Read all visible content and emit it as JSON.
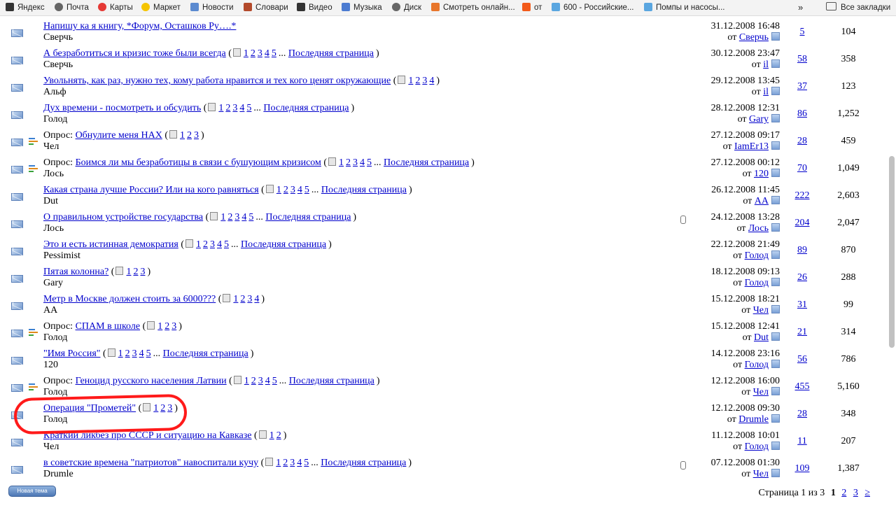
{
  "bookmarks": [
    {
      "label": "Яндекс",
      "icon": "yandex-icon",
      "color": "#333333"
    },
    {
      "label": "Почта",
      "icon": "globe-icon",
      "color": "#666666"
    },
    {
      "label": "Карты",
      "icon": "map-pin-icon",
      "color": "#e53935"
    },
    {
      "label": "Маркет",
      "icon": "market-icon",
      "color": "#f5c400"
    },
    {
      "label": "Новости",
      "icon": "news-icon",
      "color": "#5b8ad0"
    },
    {
      "label": "Словари",
      "icon": "dictionary-icon",
      "color": "#b34a2b"
    },
    {
      "label": "Видео",
      "icon": "video-icon",
      "color": "#333333"
    },
    {
      "label": "Музыка",
      "icon": "music-icon",
      "color": "#4b7bd1"
    },
    {
      "label": "Диск",
      "icon": "globe-icon",
      "color": "#666666"
    },
    {
      "label": "Смотреть онлайн...",
      "icon": "film-icon",
      "color": "#e8762b"
    },
    {
      "label": "от",
      "icon": "fire-icon",
      "color": "#f25a1a"
    },
    {
      "label": "600 - Российские...",
      "icon": "bookmark-icon",
      "color": "#5aa6e0"
    },
    {
      "label": "Помпы и насосы...",
      "icon": "bookmark-icon",
      "color": "#5aa6e0"
    }
  ],
  "bookmarks_more": "»",
  "all_bookmarks": "Все закладки",
  "topics": [
    {
      "prefix": "",
      "title": "Напишу ка я книгу, *Форум, Осташков Ру….*",
      "pages": [],
      "last": false,
      "author": "Сверчь",
      "date": "31.12.2008 16:48",
      "last_by": "Сверчь",
      "replies": "5",
      "views": "104",
      "poll": false,
      "attach": false
    },
    {
      "prefix": "",
      "title": "А безработиться и кризис тоже были всегда",
      "pages": [
        "1",
        "2",
        "3",
        "4",
        "5"
      ],
      "last": true,
      "author": "Сверчь",
      "date": "30.12.2008 23:47",
      "last_by": "il",
      "replies": "58",
      "views": "358",
      "poll": false,
      "attach": false
    },
    {
      "prefix": "",
      "title": "Увольнять, как раз, нужно тех, кому работа нравится и тех кого ценят окружающие",
      "pages": [
        "1",
        "2",
        "3",
        "4"
      ],
      "last": false,
      "author": "Альф",
      "date": "29.12.2008 13:45",
      "last_by": "il",
      "replies": "37",
      "views": "123",
      "poll": false,
      "attach": false
    },
    {
      "prefix": "",
      "title": "Дух времени - посмотреть и обсудить",
      "pages": [
        "1",
        "2",
        "3",
        "4",
        "5"
      ],
      "last": true,
      "author": "Голод",
      "date": "28.12.2008 12:31",
      "last_by": "Gary",
      "replies": "86",
      "views": "1,252",
      "poll": false,
      "attach": false
    },
    {
      "prefix": "Опрос:",
      "title": "Обнулите меня НАХ",
      "pages": [
        "1",
        "2",
        "3"
      ],
      "last": false,
      "author": "Чел",
      "date": "27.12.2008 09:17",
      "last_by": "IamEr13",
      "replies": "28",
      "views": "459",
      "poll": true,
      "attach": false
    },
    {
      "prefix": "Опрос:",
      "title": "Боимся ли мы безработицы в связи с бушующим кризисом",
      "pages": [
        "1",
        "2",
        "3",
        "4",
        "5"
      ],
      "last": true,
      "author": "Лось",
      "date": "27.12.2008 00:12",
      "last_by": "120",
      "replies": "70",
      "views": "1,049",
      "poll": true,
      "attach": false
    },
    {
      "prefix": "",
      "title": "Какая страна лучше России? Или на кого равняться",
      "pages": [
        "1",
        "2",
        "3",
        "4",
        "5"
      ],
      "last": true,
      "author": "Dut",
      "date": "26.12.2008 11:45",
      "last_by": "AA",
      "replies": "222",
      "views": "2,603",
      "poll": false,
      "attach": false
    },
    {
      "prefix": "",
      "title": "О правильном устройстве государства",
      "pages": [
        "1",
        "2",
        "3",
        "4",
        "5"
      ],
      "last": true,
      "author": "Лось",
      "date": "24.12.2008 13:28",
      "last_by": "Лось",
      "replies": "204",
      "views": "2,047",
      "poll": false,
      "attach": true
    },
    {
      "prefix": "",
      "title": "Это и есть истинная демократия",
      "pages": [
        "1",
        "2",
        "3",
        "4",
        "5"
      ],
      "last": true,
      "author": "Pessimist",
      "date": "22.12.2008 21:49",
      "last_by": "Голод",
      "replies": "89",
      "views": "870",
      "poll": false,
      "attach": false
    },
    {
      "prefix": "",
      "title": "Пятая колонна?",
      "pages": [
        "1",
        "2",
        "3"
      ],
      "last": false,
      "author": "Gary",
      "date": "18.12.2008 09:13",
      "last_by": "Голод",
      "replies": "26",
      "views": "288",
      "poll": false,
      "attach": false
    },
    {
      "prefix": "",
      "title": "Метр в Москве должен стоить за 6000???",
      "pages": [
        "1",
        "2",
        "3",
        "4"
      ],
      "last": false,
      "author": "AA",
      "date": "15.12.2008 18:21",
      "last_by": "Чел",
      "replies": "31",
      "views": "99",
      "poll": false,
      "attach": false
    },
    {
      "prefix": "Опрос:",
      "title": "СПАМ в школе",
      "pages": [
        "1",
        "2",
        "3"
      ],
      "last": false,
      "author": "Голод",
      "date": "15.12.2008 12:41",
      "last_by": "Dut",
      "replies": "21",
      "views": "314",
      "poll": true,
      "attach": false
    },
    {
      "prefix": "",
      "title": "\"Имя Россия\"",
      "pages": [
        "1",
        "2",
        "3",
        "4",
        "5"
      ],
      "last": true,
      "author": "120",
      "date": "14.12.2008 23:16",
      "last_by": "Голод",
      "replies": "56",
      "views": "786",
      "poll": false,
      "attach": false
    },
    {
      "prefix": "Опрос:",
      "title": "Геноцид русского населения Латвии",
      "pages": [
        "1",
        "2",
        "3",
        "4",
        "5"
      ],
      "last": true,
      "author": "Голод",
      "date": "12.12.2008 16:00",
      "last_by": "Чел",
      "replies": "455",
      "views": "5,160",
      "poll": true,
      "attach": false
    },
    {
      "prefix": "",
      "title": "Операция \"Прометей\"",
      "pages": [
        "1",
        "2",
        "3"
      ],
      "last": false,
      "author": "Голод",
      "date": "12.12.2008 09:30",
      "last_by": "Drumle",
      "replies": "28",
      "views": "348",
      "poll": false,
      "attach": false
    },
    {
      "prefix": "",
      "title": "Краткий ликбез про СССР и ситуацию на Кавказе",
      "pages": [
        "1",
        "2"
      ],
      "last": false,
      "author": "Чел",
      "date": "11.12.2008 10:01",
      "last_by": "Голод",
      "replies": "11",
      "views": "207",
      "poll": false,
      "attach": false
    },
    {
      "prefix": "",
      "title": "в советские времена \"патриотов\" навоспитали кучу",
      "pages": [
        "1",
        "2",
        "3",
        "4",
        "5"
      ],
      "last": true,
      "author": "Drumle",
      "date": "07.12.2008 01:30",
      "last_by": "Чел",
      "replies": "109",
      "views": "1,387",
      "poll": false,
      "attach": true
    }
  ],
  "labels": {
    "last_page": "Последняя страница",
    "ellipsis": "...",
    "from": "от",
    "new_topic": "Новая тема"
  },
  "pagination": {
    "text": "Страница 1 из 3",
    "current": "1",
    "pages": [
      "2",
      "3"
    ],
    "next": "≥"
  },
  "highlight_color": "#ff1a1a"
}
